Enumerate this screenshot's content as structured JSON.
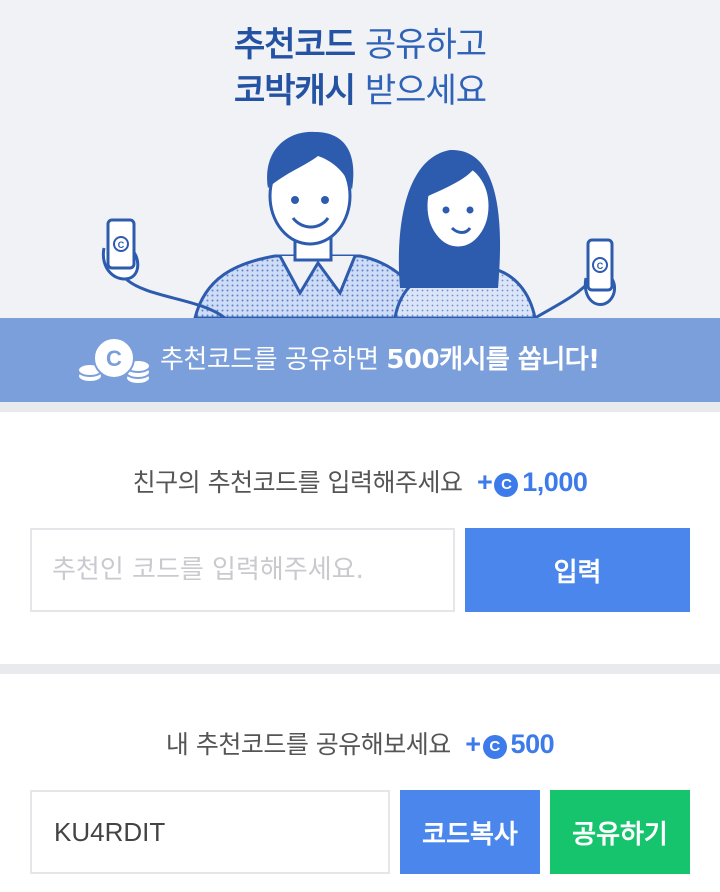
{
  "hero": {
    "line1_strong": "추천코드",
    "line1_rest": " 공유하고",
    "line2_strong": "코박캐시",
    "line2_rest": " 받으세요"
  },
  "banner": {
    "text_prefix": "추천코드를 공유하면 ",
    "text_bold": "500캐시를 쏩니다!"
  },
  "enter_section": {
    "title": "친구의 추천코드를 입력해주세요",
    "reward_plus": "+",
    "coin_symbol": "C",
    "reward_amount": "1,000",
    "input_placeholder": "추천인 코드를 입력해주세요.",
    "input_value": "",
    "submit_label": "입력"
  },
  "share_section": {
    "title": "내 추천코드를 공유해보세요",
    "reward_plus": "+",
    "coin_symbol": "C",
    "reward_amount": "500",
    "my_code": "KU4RDIT",
    "copy_label": "코드복사",
    "share_label": "공유하기"
  },
  "colors": {
    "accent_blue": "#4a86ec",
    "banner_blue": "#7b9fdb",
    "share_green": "#16c46e",
    "headline_blue": "#2553a4"
  }
}
